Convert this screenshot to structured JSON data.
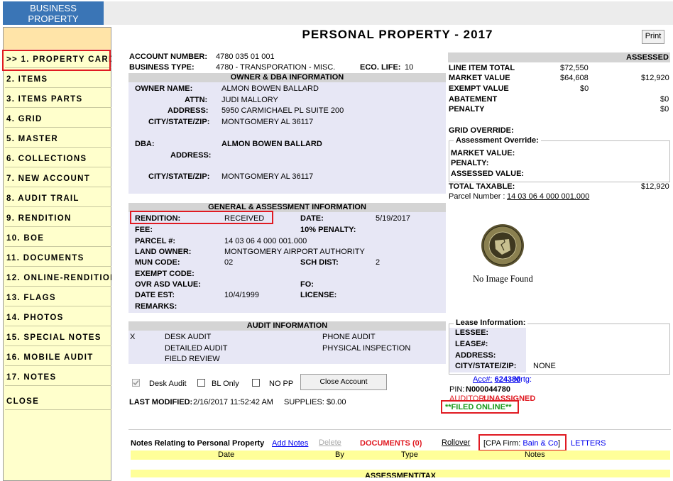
{
  "tab": {
    "line1": "BUSINESS",
    "line2": "PROPERTY"
  },
  "sidebar": {
    "items": [
      ">> 1. PROPERTY CARD",
      "2. ITEMS",
      "3. ITEMS PARTS",
      "4. GRID",
      "5. MASTER",
      "6. COLLECTIONS",
      "7. NEW ACCOUNT",
      "8. AUDIT TRAIL",
      "9. RENDITION",
      "10. BOE",
      "11. DOCUMENTS",
      "12. ONLINE-RENDITION",
      "13. FLAGS",
      "14. PHOTOS",
      "15. SPECIAL NOTES",
      "16. MOBILE AUDIT",
      "17. NOTES",
      "CLOSE"
    ]
  },
  "header": {
    "title": "PERSONAL PROPERTY - 2017",
    "print_label": "Print"
  },
  "account": {
    "account_number_label": "ACCOUNT NUMBER:",
    "account_number": "4780 035 01 001",
    "business_type_label": "BUSINESS TYPE:",
    "business_type": "4780 - TRANSPORATION - MISC.",
    "eco_life_label": "ECO. LIFE:",
    "eco_life": "10"
  },
  "owner": {
    "section_title": "OWNER & DBA INFORMATION",
    "owner_name_label": "OWNER NAME:",
    "owner_name": "ALMON BOWEN BALLARD",
    "attn_label": "ATTN:",
    "attn": "JUDI MALLORY",
    "address_label": "ADDRESS:",
    "address": "5950 CARMICHAEL PL SUITE 200",
    "csz_label": "CITY/STATE/ZIP:",
    "csz": "MONTGOMERY AL  36117",
    "dba_label": "DBA:",
    "dba": "ALMON BOWEN BALLARD",
    "dba_address_label": "ADDRESS:",
    "dba_csz_label": "CITY/STATE/ZIP:",
    "dba_csz": "MONTGOMERY  AL  36117"
  },
  "general": {
    "section_title": "GENERAL & ASSESSMENT INFORMATION",
    "rendition_label": "RENDITION:",
    "rendition": "RECEIVED",
    "date_label": "DATE:",
    "date": "5/19/2017",
    "fee_label": "FEE:",
    "penalty10_label": "10% PENALTY:",
    "parcel_label": "PARCEL #:",
    "parcel": "14 03 06 4 000 001.000",
    "land_owner_label": "LAND OWNER:",
    "land_owner": "MONTGOMERY AIRPORT AUTHORITY",
    "mun_code_label": "MUN CODE:",
    "mun_code": "02",
    "sch_dist_label": "SCH DIST:",
    "sch_dist": "2",
    "exempt_code_label": "EXEMPT CODE:",
    "ovr_asd_label": "OVR ASD VALUE:",
    "fo_label": "FO:",
    "date_est_label": "DATE EST:",
    "date_est": "10/4/1999",
    "license_label": "LICENSE:",
    "remarks_label": "REMARKS:"
  },
  "audit": {
    "section_title": "AUDIT INFORMATION",
    "mark": "X",
    "desk": "DESK AUDIT",
    "detailed": "DETAILED AUDIT",
    "field": "FIELD REVIEW",
    "phone": "PHONE AUDIT",
    "physical": "PHYSICAL INSPECTION"
  },
  "checks": {
    "desk_audit": "Desk Audit",
    "desk_audit_checked": true,
    "bl_only": "BL Only",
    "no_pp": "NO PP",
    "close_account": "Close Account"
  },
  "last_modified": {
    "label": "LAST MODIFIED:",
    "value": "2/16/2017 11:52:42 AM",
    "supplies_label": "SUPPLIES:",
    "supplies": "$0.00"
  },
  "totals": {
    "assessed_header": "ASSESSED",
    "line_item_total_label": "LINE ITEM TOTAL",
    "line_item_total": "$72,550",
    "market_value_label": "MARKET VALUE",
    "market_value": "$64,608",
    "market_assessed": "$12,920",
    "exempt_value_label": "EXEMPT VALUE",
    "exempt_value": "$0",
    "abatement_label": "ABATEMENT",
    "abatement": "$0",
    "penalty_label": "PENALTY",
    "penalty": "$0",
    "grid_override_label": "GRID OVERRIDE:",
    "assessment_override_legend": "Assessment Override:",
    "ao_market_label": "MARKET VALUE:",
    "ao_penalty_label": "PENALTY:",
    "ao_assessed_label": "ASSESSED VALUE:",
    "total_taxable_label": "TOTAL TAXABLE:",
    "total_taxable": "$12,920",
    "parcel_number_label": "Parcel Number :",
    "parcel_number": "14 03 06 4 000 001.000"
  },
  "image": {
    "seal_text": "MONTGOMERY COUNTY ALABAMA",
    "no_image": "No Image Found"
  },
  "lease": {
    "legend": "Lease Information:",
    "lessee_label": "LESSEE:",
    "lease_label": "LEASE#:",
    "address_label": "ADDRESS:",
    "csz_label": "CITY/STATE/ZIP:",
    "csz": "NONE"
  },
  "misc": {
    "acc_label": "Acc#:",
    "acc_value": "624380",
    "mrtg": "Mrtg:",
    "pin_label": "PIN:",
    "pin": "N000044780",
    "auditor_label": "AUDITOR:",
    "auditor": "UNASSIGNED",
    "filed_online": "**FILED ONLINE**"
  },
  "notes": {
    "title": "Notes Relating to Personal Property",
    "add_notes": "Add Notes",
    "delete": "Delete",
    "documents": "DOCUMENTS (0)",
    "rollover": "Rollover",
    "cpa_label": "[CPA Firm:",
    "cpa_firm": "Bain & Co",
    "cpa_close": "]",
    "letters": "LETTERS",
    "columns": [
      "Date",
      "By",
      "Type",
      "Notes"
    ],
    "bottom_section": "ASSESSMENT/TAX"
  },
  "colors": {
    "accent_red": "#e01a22",
    "link_blue": "#0000ee",
    "filed_green": "#1a9a1a",
    "sidebar_bg": "#ffffcc",
    "tab_blue": "#3a75b6"
  }
}
